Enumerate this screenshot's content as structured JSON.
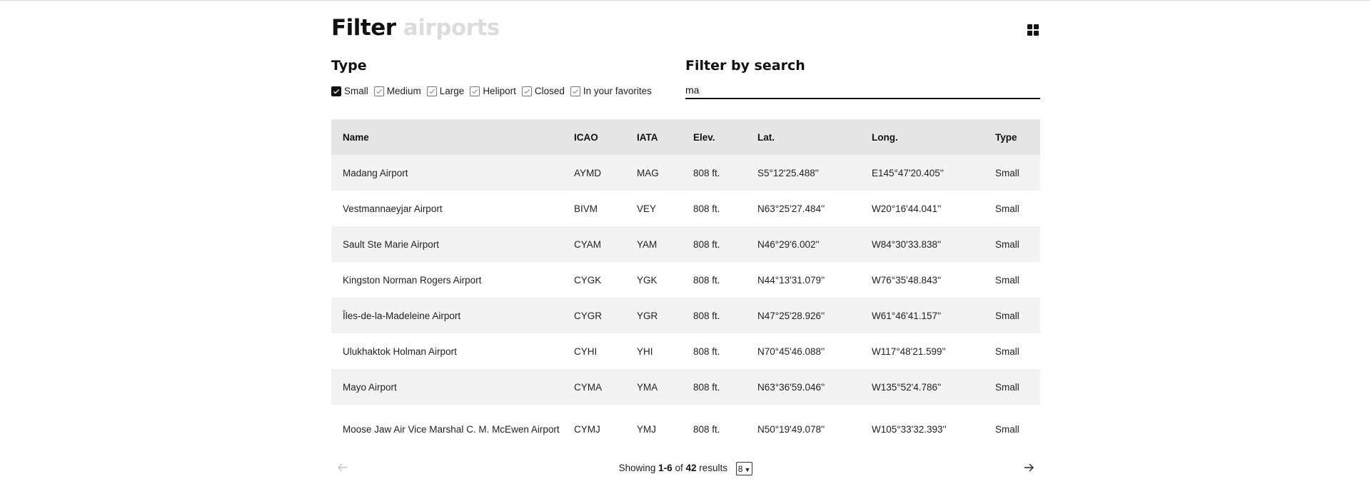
{
  "header": {
    "title_main": "Filter",
    "title_muted": "airports",
    "grid_icon": "grid-icon"
  },
  "filters": {
    "type_title": "Type",
    "search_title": "Filter by search",
    "types": [
      {
        "label": "Small",
        "checked": true
      },
      {
        "label": "Medium",
        "checked": false
      },
      {
        "label": "Large",
        "checked": false
      },
      {
        "label": "Heliport",
        "checked": false
      },
      {
        "label": "Closed",
        "checked": false
      },
      {
        "label": "In your favorites",
        "checked": false
      }
    ],
    "search_value": "ma"
  },
  "table": {
    "columns": [
      "Name",
      "ICAO",
      "IATA",
      "Elev.",
      "Lat.",
      "Long.",
      "Type"
    ],
    "rows": [
      [
        "Madang Airport",
        "AYMD",
        "MAG",
        "808 ft.",
        "S5°12'25.488''",
        "E145°47'20.405''",
        "Small"
      ],
      [
        "Vestmannaeyjar Airport",
        "BIVM",
        "VEY",
        "808 ft.",
        "N63°25'27.484''",
        "W20°16'44.041''",
        "Small"
      ],
      [
        "Sault Ste Marie Airport",
        "CYAM",
        "YAM",
        "808 ft.",
        "N46°29'6.002''",
        "W84°30'33.838''",
        "Small"
      ],
      [
        "Kingston Norman Rogers Airport",
        "CYGK",
        "YGK",
        "808 ft.",
        "N44°13'31.079''",
        "W76°35'48.843''",
        "Small"
      ],
      [
        "Îles-de-la-Madeleine Airport",
        "CYGR",
        "YGR",
        "808 ft.",
        "N47°25'28.926''",
        "W61°46'41.157''",
        "Small"
      ],
      [
        "Ulukhaktok Holman Airport",
        "CYHI",
        "YHI",
        "808 ft.",
        "N70°45'46.088''",
        "W117°48'21.599''",
        "Small"
      ],
      [
        "Mayo Airport",
        "CYMA",
        "YMA",
        "808 ft.",
        "N63°36'59.046''",
        "W135°52'4.786''",
        "Small"
      ],
      [
        "Moose Jaw Air Vice Marshal C. M. McEwen Airport",
        "CYMJ",
        "YMJ",
        "808 ft.",
        "N50°19'49.078''",
        "W105°33'32.393''",
        "Small"
      ]
    ]
  },
  "pagination": {
    "showing": "Showing",
    "range": "1-6",
    "of": "of",
    "total": "42",
    "results": "results",
    "per_page": "8",
    "prev_icon": "arrow-left-icon",
    "next_icon": "arrow-right-icon"
  }
}
